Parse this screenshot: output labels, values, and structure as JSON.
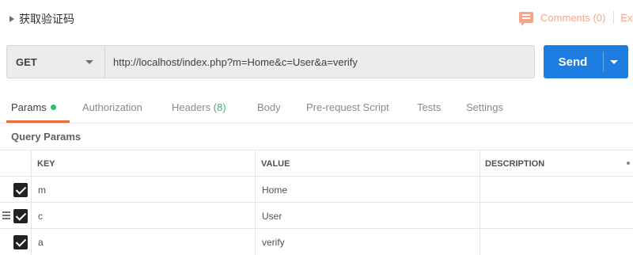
{
  "request": {
    "title": "获取验证码",
    "comments_label": "Comments (0)",
    "examples_label": "Ex",
    "method": "GET",
    "url": "http://localhost/index.php?m=Home&c=User&a=verify",
    "send_label": "Send"
  },
  "tabs": [
    {
      "label": "Params",
      "active": true
    },
    {
      "label": "Authorization"
    },
    {
      "label": "Headers"
    },
    {
      "label": "Body"
    },
    {
      "label": "Pre-request Script"
    },
    {
      "label": "Tests"
    },
    {
      "label": "Settings"
    }
  ],
  "headers_count": "(8)",
  "query_params_label": "Query Params",
  "table": {
    "columns": [
      "KEY",
      "VALUE",
      "DESCRIPTION"
    ],
    "rows": [
      {
        "key": "m",
        "value": "Home",
        "description": "",
        "checked": true
      },
      {
        "key": "c",
        "value": "User",
        "description": "",
        "checked": true
      },
      {
        "key": "a",
        "value": "verify",
        "description": "",
        "checked": true
      }
    ]
  },
  "colors": {
    "accent": "#f26b3a",
    "send": "#1e7de0",
    "dot": "#2ebd75",
    "comments": "#f6a58c"
  }
}
